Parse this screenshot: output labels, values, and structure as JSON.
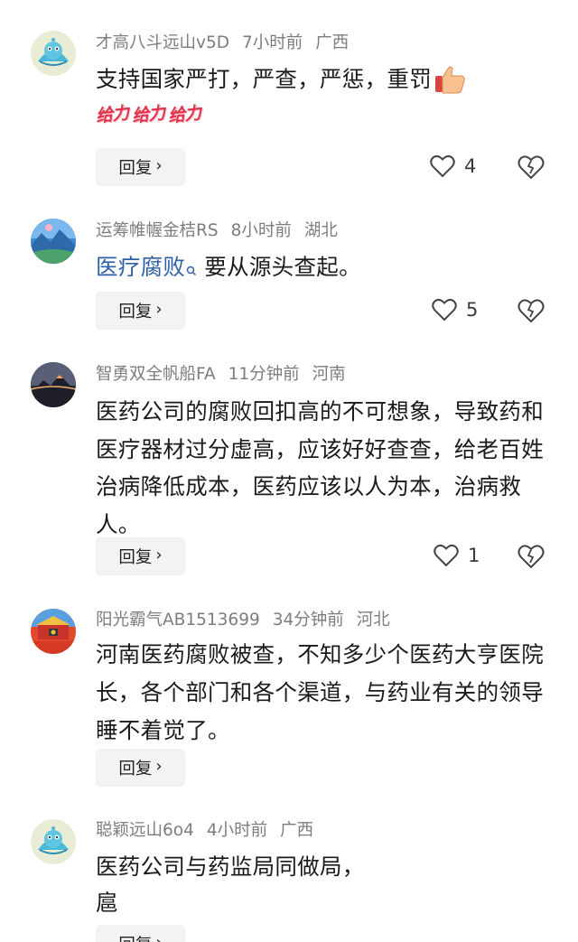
{
  "comments": [
    {
      "username": "才高八斗远山v5D",
      "time": "7小时前",
      "location": "广西",
      "text": "支持国家严打，严查，严惩，重罚",
      "stickers": [
        "给力",
        "给力",
        "给力"
      ],
      "reply_label": "回复",
      "likes": "4",
      "avatar": "blue-character-avatar"
    },
    {
      "username": "运筹帷幄金桔RS",
      "time": "8小时前",
      "location": "湖北",
      "link_text": "医疗腐败",
      "text": "要从源头查起。",
      "reply_label": "回复",
      "likes": "5",
      "avatar": "landscape-avatar"
    },
    {
      "username": "智勇双全帆船FA",
      "time": "11分钟前",
      "location": "河南",
      "text": "医药公司的腐败回扣高的不可想象，导致药和医疗器材过分虚高，应该好好查查，给老百姓治病降低成本，医药应该以人为本，治病救人。",
      "reply_label": "回复",
      "likes": "1",
      "avatar": "mountain-sunset-avatar"
    },
    {
      "username": "阳光霸气AB1513699",
      "time": "34分钟前",
      "location": "河北",
      "text": "河南医药腐败被查，不知多少个医药大亨医院长，各个部门和各个渠道，与药业有关的领导睡不着觉了。",
      "reply_label": "回复",
      "avatar": "tiananmen-avatar"
    },
    {
      "username": "聪颖远山6o4",
      "time": "4小时前",
      "location": "广西",
      "text": "医药公司与药监局同做局，",
      "text_line2": "扈",
      "reply_label": "回复",
      "avatar": "blue-character-avatar"
    }
  ],
  "colors": {
    "meta_gray": "#7d7d7d",
    "link_blue": "#2f5fa8",
    "reply_bg": "#f3f3f3"
  }
}
